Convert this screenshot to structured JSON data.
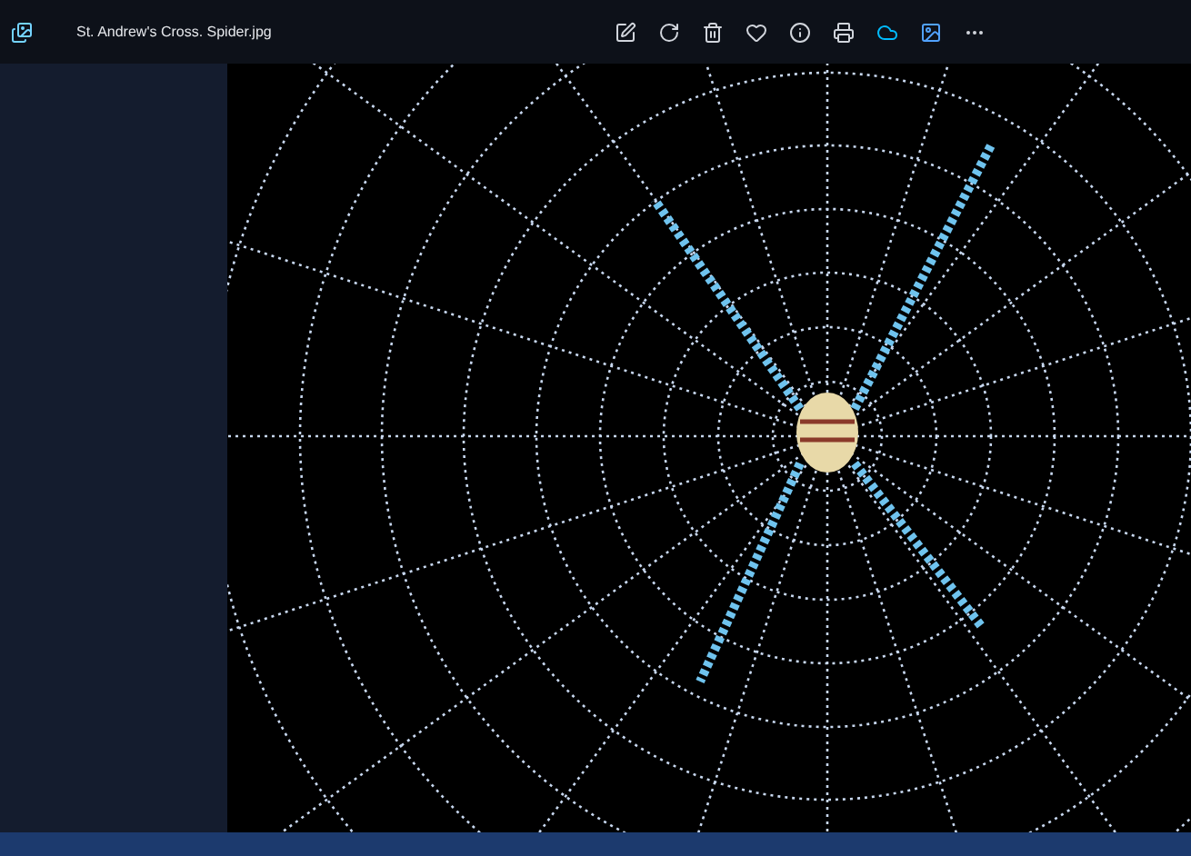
{
  "window": {
    "title": "St. Andrew's Cross.  Spider.jpg"
  }
}
